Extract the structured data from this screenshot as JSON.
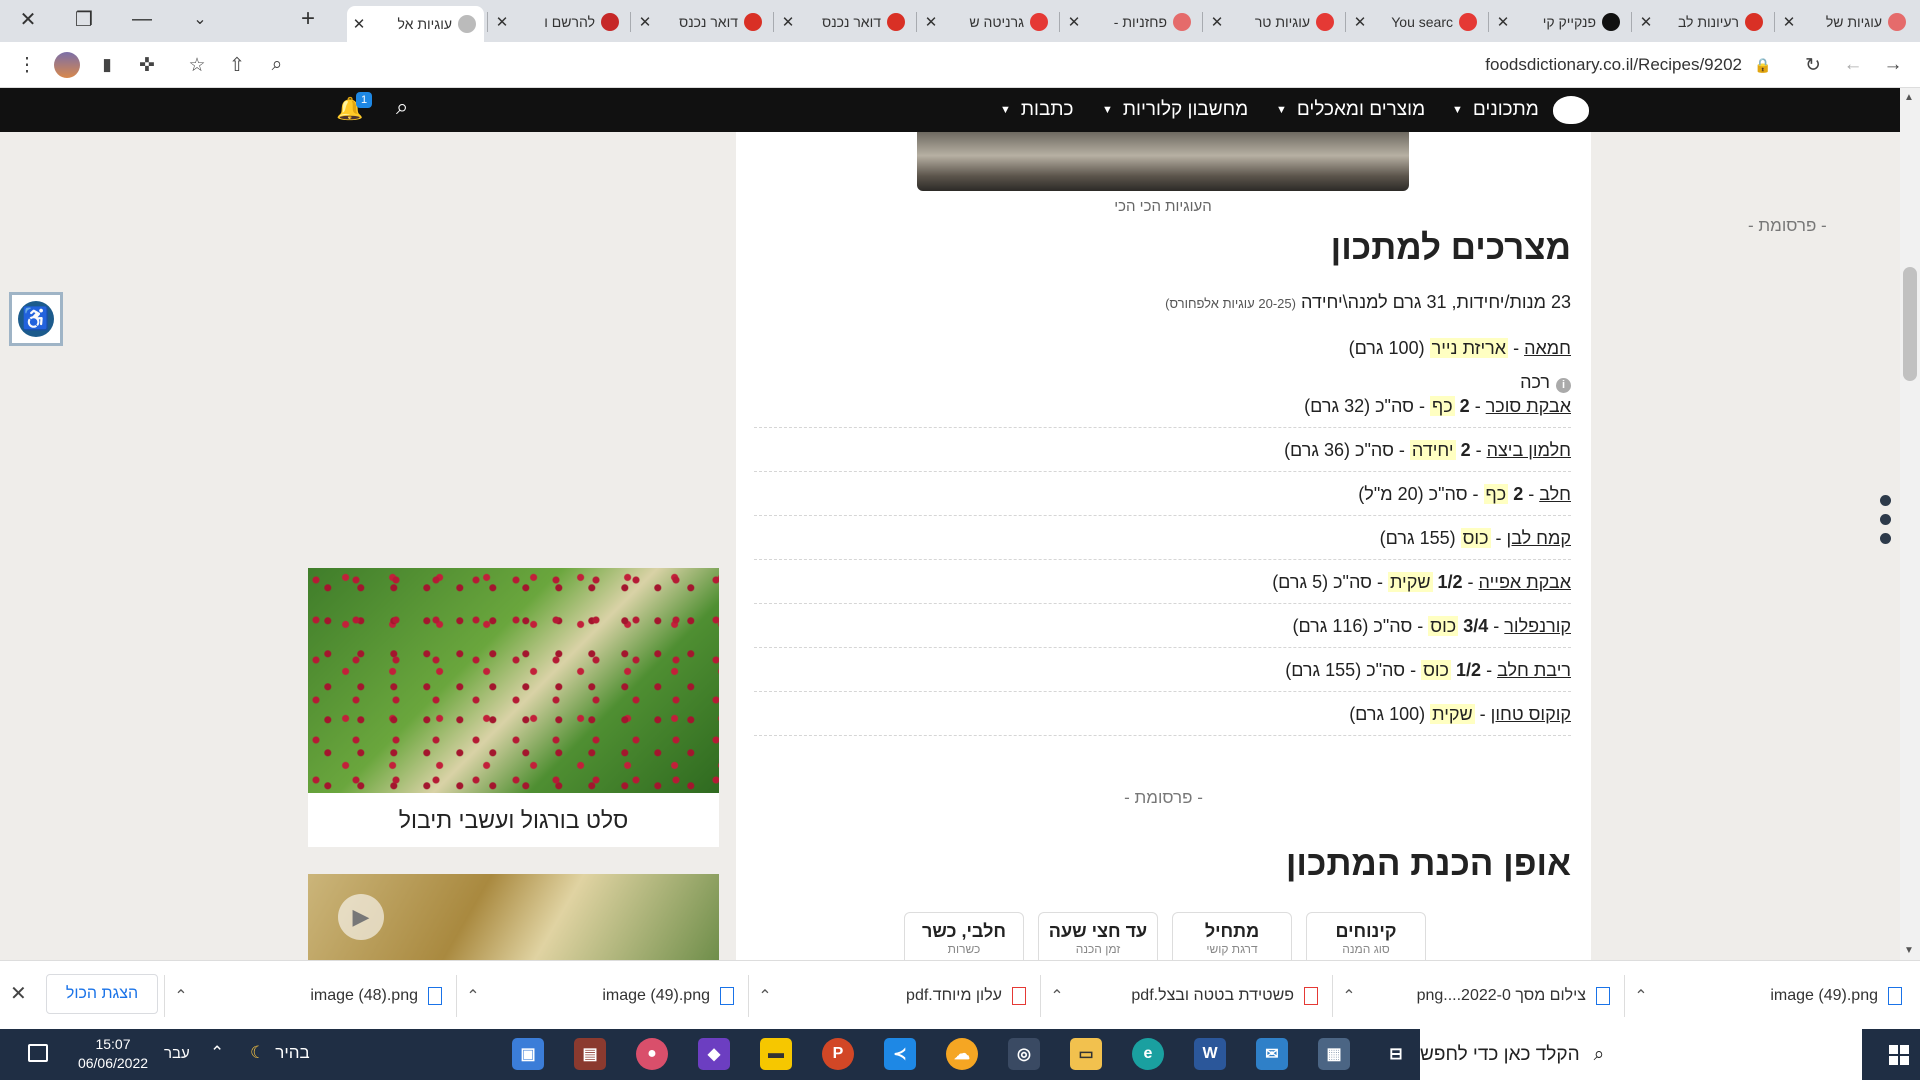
{
  "browser": {
    "tabs": [
      {
        "title": "עוגיות של",
        "color": "#e56b6b"
      },
      {
        "title": "רעיונות לב",
        "color": "#d93025"
      },
      {
        "title": "פנקייק קי",
        "color": "#111111"
      },
      {
        "title": "You searc",
        "color": "#e53935"
      },
      {
        "title": "עוגיות טר",
        "color": "#e53935"
      },
      {
        "title": "פחזניות -",
        "color": "#e56b6b"
      },
      {
        "title": "גרניטה ש",
        "color": "#e53935"
      },
      {
        "title": "דואר נכנס",
        "color": "#d93025"
      },
      {
        "title": "דואר נכנס",
        "color": "#d93025"
      },
      {
        "title": "להרשם ו",
        "color": "#c62828"
      },
      {
        "title": "עוגיות אל",
        "color": "#bbbbbb"
      }
    ],
    "url": "foodsdictionary.co.il/Recipes/9202"
  },
  "site": {
    "nav": [
      {
        "label": "מתכונים"
      },
      {
        "label": "מוצרים ומאכלים"
      },
      {
        "label": "מחשבון קלוריות"
      },
      {
        "label": "כתבות"
      }
    ],
    "bell_count": "1"
  },
  "recipe": {
    "photo_caption": "העוגיות הכי הכי",
    "ingredients_heading": "מצרכים למתכון",
    "servings": "23 מנות/יחידות, 31 גרם למנה\\יחידה",
    "servings_note": "(20-25 עוגיות אלפחורס)",
    "ingredients": [
      {
        "name": "חמאה",
        "sep1": " - ",
        "qty": "",
        "unit": "אריזת נייר",
        "rest": " (100 גרם)"
      },
      {
        "name": "אבקת סוכר",
        "sep1": " - ",
        "qty": "2 ",
        "unit": "כף",
        "rest": " - סה\"כ (32 גרם)"
      },
      {
        "name": "חלמון ביצה",
        "sep1": " - ",
        "qty": "2 ",
        "unit": "יחידה",
        "rest": " - סה\"כ (36 גרם)"
      },
      {
        "name": "חלב",
        "sep1": " - ",
        "qty": "2 ",
        "unit": "כף",
        "rest": " - סה\"כ (20 מ\"ל)"
      },
      {
        "name": "קמח לבן",
        "sep1": " - ",
        "qty": "",
        "unit": "כוס",
        "rest": " (155 גרם)"
      },
      {
        "name": "אבקת אפייה",
        "sep1": " - ",
        "qty": "1/2 ",
        "unit": "שקית",
        "rest": " - סה\"כ (5 גרם)"
      },
      {
        "name": "קורנפלור",
        "sep1": " - ",
        "qty": "3/4 ",
        "unit": "כוס",
        "rest": " - סה\"כ (116 גרם)"
      },
      {
        "name": "ריבת חלב",
        "sep1": " - ",
        "qty": "1/2 ",
        "unit": "כוס",
        "rest": " - סה\"כ (155 גרם)"
      },
      {
        "name": "קוקוס טחון",
        "sep1": " - ",
        "qty": "",
        "unit": "שקית",
        "rest": " (100 גרם)"
      }
    ],
    "butter_note": "רכה",
    "ad_label": "- פרסומת -",
    "prep_heading": "אופן הכנת המתכון",
    "tags": [
      {
        "value": "קינוחים",
        "label": "סוג המנה"
      },
      {
        "value": "מתחיל",
        "label": "דרגת קושי"
      },
      {
        "value": "עד חצי שעה",
        "label": "זמן הכנה"
      },
      {
        "value": "חלבי, כשר",
        "label": "כשרות"
      }
    ]
  },
  "sidebar": {
    "ad_label": "- פרסומת -",
    "card1_title": "סלט בורגול ועשבי תיבול"
  },
  "downloads": [
    {
      "name": "image (49).png",
      "type": "png"
    },
    {
      "name": "צילום מסך 2022-0....png",
      "type": "png"
    },
    {
      "name": "פשטידת בטטה ובצל.pdf",
      "type": "pdf"
    },
    {
      "name": "עלון מיוחד.pdf",
      "type": "pdf"
    },
    {
      "name": "image (49).png",
      "type": "png"
    },
    {
      "name": "image (48).png",
      "type": "png"
    }
  ],
  "downloads_show_all": "הצגת הכול",
  "taskbar": {
    "search_placeholder": "הקלד כאן כדי לחפש",
    "time": "15:07",
    "date": "06/06/2022",
    "lang": "עבר",
    "weather": "בהיר"
  }
}
